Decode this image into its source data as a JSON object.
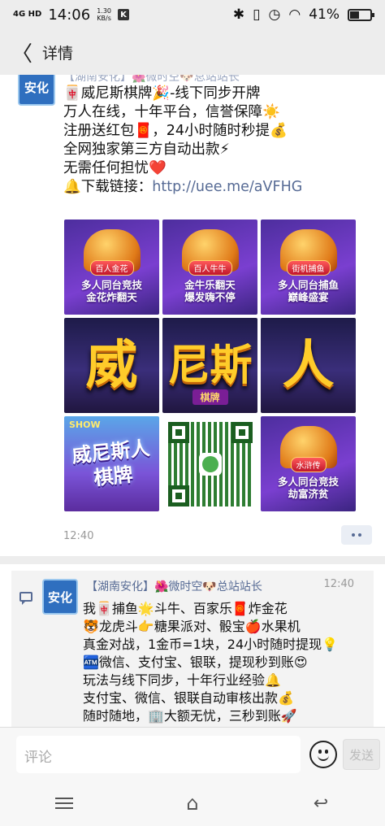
{
  "status_bar": {
    "network": "4G HD",
    "time": "14:06",
    "speed_value": "1.30",
    "speed_unit": "KB/s",
    "app_badge": "K",
    "battery_percent": "41%",
    "battery_level": 0.41
  },
  "header": {
    "back_icon": "chevron-left-icon",
    "title": "详情"
  },
  "post1": {
    "avatar_text": "安化",
    "author_partial": "【湖南安化】🌺微时空🐶总站站长",
    "lines": [
      "🀄威尼斯棋牌🎉-线下同步开牌",
      "万人在线，十年平台，信誉保障☀️",
      "注册送红包🧧，24小时随时秒提💰",
      "全网独家第三方自动出款⚡",
      "无需任何担忧❤️"
    ],
    "download_label": "🔔下载链接：",
    "download_url": "http://uee.me/aVFHG",
    "images": [
      {
        "badge": "百人金花",
        "caption": "多人同台竞技\n金花炸翻天"
      },
      {
        "badge": "百人牛牛",
        "caption": "金牛乐翻天\n爆发嗨不停"
      },
      {
        "badge": "街机捕鱼",
        "caption": "多人同台捕鱼\n巅峰盛宴"
      },
      {
        "big": "威"
      },
      {
        "big": "尼斯",
        "sub": "棋牌"
      },
      {
        "big": "人"
      },
      {
        "tag": "SHOW",
        "text": "威尼斯人\n棋牌"
      },
      {
        "qr": true
      },
      {
        "badge": "水浒传",
        "caption": "多人同台竞技\n劫富济贫"
      }
    ],
    "time": "12:40"
  },
  "post2": {
    "avatar_text": "安化",
    "author": "【湖南安化】🌺微时空🐶总站站长",
    "time": "12:40",
    "lines": [
      "我🀄捕鱼🌟斗牛、百家乐🧧炸金花",
      "🐯龙虎斗👉糖果派对、骰宝🍎水果机",
      " 真金对战，1金币=1块，24小时随时提现💡",
      "🏧微信、支付宝、银联，提现秒到账😍",
      "玩法与线下同步，十年行业经验🔔",
      "支付宝、微信、银联自动审核出款💰",
      "随时随地，🏢大额无忧，三秒到账🚀"
    ]
  },
  "input_bar": {
    "placeholder": "评论",
    "emoji_icon": "emoji-icon",
    "send_label": "发送"
  },
  "nav_bar": {
    "menu_icon": "menu-icon",
    "home_icon": "home-icon",
    "back_icon": "back-icon"
  }
}
